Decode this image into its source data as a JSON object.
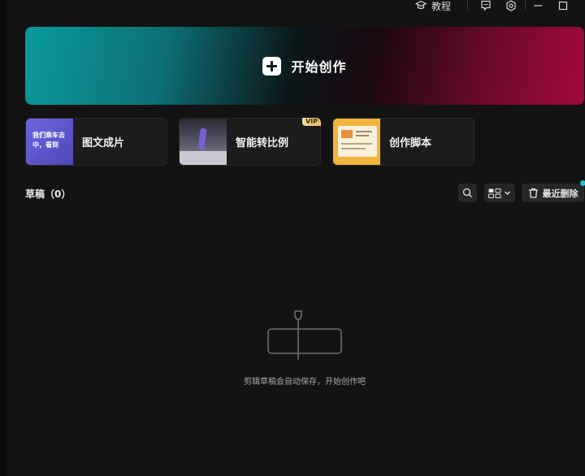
{
  "titlebar": {
    "tutorial_label": "教程",
    "icons": [
      "graduation-cap-icon",
      "feedback-icon",
      "settings-icon",
      "minimize-icon",
      "maximize-icon"
    ]
  },
  "hero": {
    "label": "开始创作",
    "icon": "plus-icon",
    "gradient_colors": [
      "#0a9a9c",
      "#0b1619",
      "#a3083a"
    ]
  },
  "cards": [
    {
      "label": "图文成片",
      "thumb_text": "我们乘车去中，看到",
      "badge": ""
    },
    {
      "label": "智能转比例",
      "badge": "VIP"
    },
    {
      "label": "创作脚本",
      "badge": ""
    }
  ],
  "drafts": {
    "title": "草稿（0）",
    "search_icon": "search-icon",
    "view_icon": "grid-view-icon",
    "recent_delete_label": "最近删除",
    "empty_message": "剪辑草稿会自动保存，开始创作吧"
  },
  "colors": {
    "background": "#131313",
    "card": "#1c1c1c",
    "accent_dot": "#19c5d8"
  }
}
